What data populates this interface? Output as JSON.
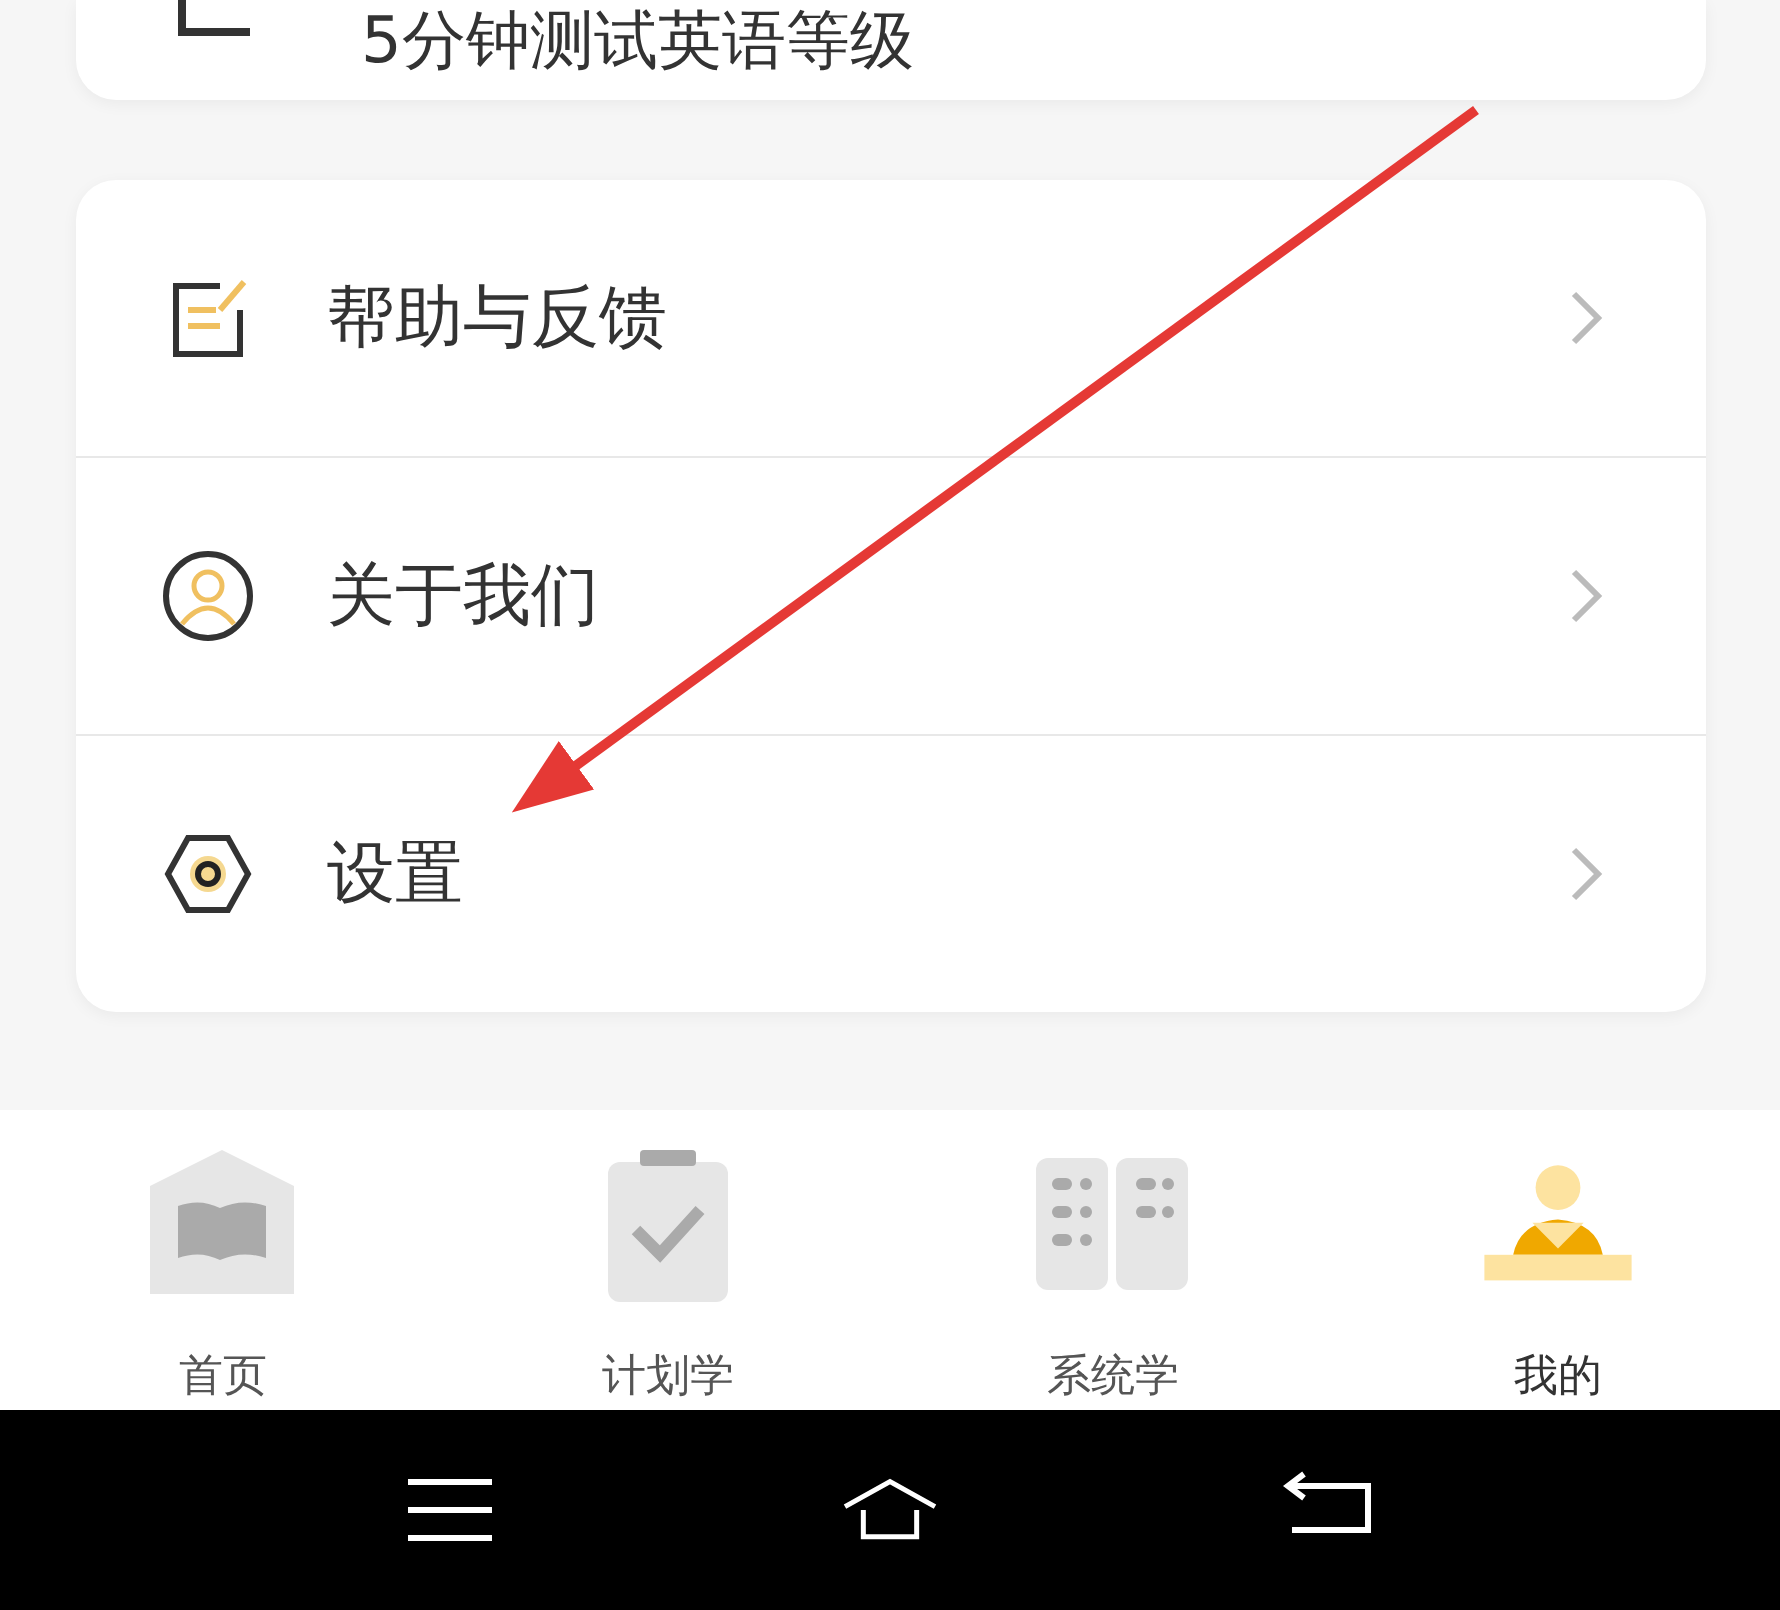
{
  "top_card": {
    "label": "5分钟测试英语等级"
  },
  "menu": [
    {
      "kind": "feedback",
      "label": "帮助与反馈"
    },
    {
      "kind": "about",
      "label": "关于我们"
    },
    {
      "kind": "settings",
      "label": "设置"
    }
  ],
  "tabs": [
    {
      "kind": "home",
      "label": "首页",
      "selected": false
    },
    {
      "kind": "plan",
      "label": "计划学",
      "selected": false
    },
    {
      "kind": "system",
      "label": "系统学",
      "selected": false
    },
    {
      "kind": "me",
      "label": "我的",
      "selected": true
    }
  ]
}
